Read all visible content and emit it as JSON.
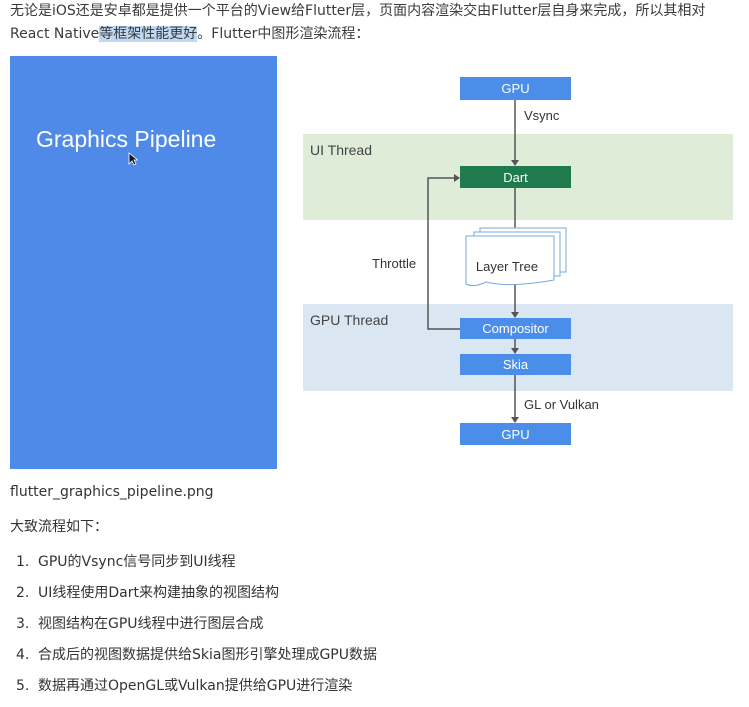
{
  "intro": {
    "line1": "无论是iOS还是安卓都是提供一个平台的View给Flutter层，页面内容渲染交由Flutter层自身来完成，所以其相对",
    "line2_prefix": "React Native",
    "line2_highlight": "等框架性能更好",
    "line2_suffix": "。Flutter中图形渲染流程："
  },
  "figure": {
    "panel_title": "Graphics Pipeline",
    "ui_thread_label": "UI Thread",
    "gpu_thread_label": "GPU Thread",
    "gpu_top": "GPU",
    "vsync_label": "Vsync",
    "dart": "Dart",
    "layer_tree": "Layer Tree",
    "throttle_label": "Throttle",
    "compositor": "Compositor",
    "skia": "Skia",
    "gl_label": "GL or Vulkan",
    "gpu_bottom": "GPU",
    "colors": {
      "panel_blue": "#4f8ae8",
      "box_blue": "#4a8eea",
      "dart_green": "#1f7a4d",
      "ui_band": "#deecd8",
      "gpu_band": "#dbe6f3"
    }
  },
  "caption": "flutter_graphics_pipeline.png",
  "summary": "大致流程如下：",
  "steps": [
    {
      "num": "1.",
      "text": "GPU的Vsync信号同步到UI线程"
    },
    {
      "num": "2.",
      "text": "UI线程使用Dart来构建抽象的视图结构"
    },
    {
      "num": "3.",
      "text": "视图结构在GPU线程中进行图层合成"
    },
    {
      "num": "4.",
      "text": "合成后的视图数据提供给Skia图形引擎处理成GPU数据"
    },
    {
      "num": "5.",
      "text": "数据再通过OpenGL或Vulkan提供给GPU进行渲染"
    }
  ]
}
